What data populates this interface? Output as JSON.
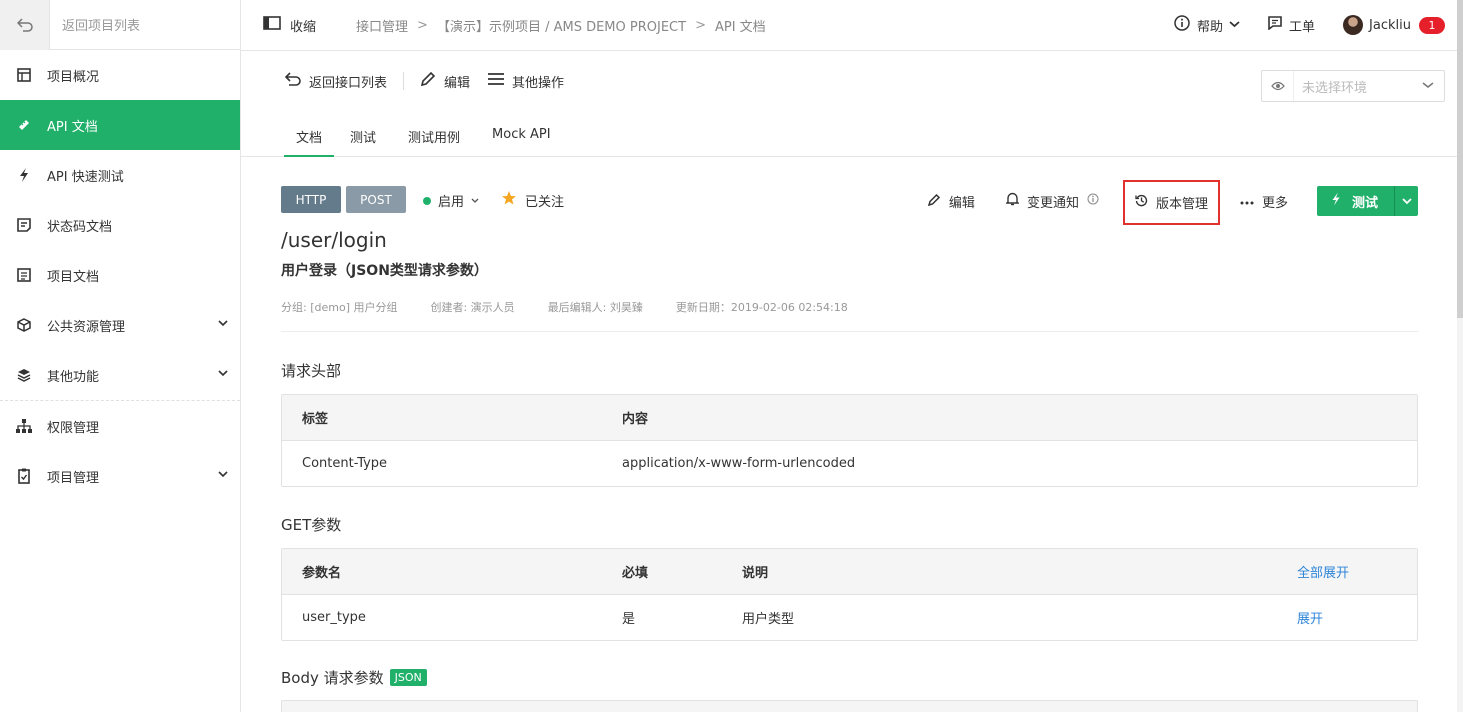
{
  "sidebar": {
    "back_label": "返回项目列表",
    "items": [
      {
        "label": "项目概况",
        "icon": "overview-icon"
      },
      {
        "label": "API 文档",
        "icon": "api-doc-icon",
        "active": true
      },
      {
        "label": "API 快速测试",
        "icon": "lightning-icon"
      },
      {
        "label": "状态码文档",
        "icon": "status-code-icon"
      },
      {
        "label": "项目文档",
        "icon": "doc-icon"
      },
      {
        "label": "公共资源管理",
        "icon": "cube-icon",
        "expandable": true
      },
      {
        "label": "其他功能",
        "icon": "layers-icon",
        "expandable": true
      },
      {
        "label": "权限管理",
        "icon": "org-chart-icon"
      },
      {
        "label": "项目管理",
        "icon": "clipboard-icon",
        "expandable": true
      }
    ]
  },
  "header": {
    "collapse_label": "收缩",
    "breadcrumbs": [
      "接口管理",
      "【演示】示例项目 / AMS DEMO PROJECT",
      "API 文档"
    ],
    "help_label": "帮助",
    "ticket_label": "工单",
    "user_name": "Jackliu",
    "notification_count": "1"
  },
  "toolbar": {
    "back_label": "返回接口列表",
    "edit_label": "编辑",
    "more_ops_label": "其他操作",
    "env_placeholder": "未选择环境",
    "tabs": [
      "文档",
      "测试",
      "测试用例",
      "Mock API"
    ]
  },
  "api": {
    "protocol": "HTTP",
    "method": "POST",
    "status": "启用",
    "follow": "已关注",
    "actions": {
      "edit": "编辑",
      "notify": "变更通知",
      "version": "版本管理",
      "more": "更多",
      "test": "测试"
    },
    "path": "/user/login",
    "name": "用户登录（JSON类型请求参数）",
    "meta": {
      "group": "分组: [demo] 用户分组",
      "creator": "创建者: 演示人员",
      "last_editor": "最后编辑人: 刘昊臻",
      "updated": "更新日期：2019-02-06 02:54:18"
    }
  },
  "request_headers": {
    "title": "请求头部",
    "columns": [
      "标签",
      "内容"
    ],
    "rows": [
      [
        "Content-Type",
        "application/x-www-form-urlencoded"
      ]
    ]
  },
  "get_params": {
    "title": "GET参数",
    "columns": [
      "参数名",
      "必填",
      "说明"
    ],
    "expand_all": "全部展开",
    "rows": [
      {
        "name": "user_type",
        "required": "是",
        "desc": "用户类型",
        "action": "展开"
      }
    ]
  },
  "body_params": {
    "title": "Body 请求参数",
    "tag": "JSON"
  },
  "colors": {
    "accent": "#20b06a",
    "link": "#2e85d9",
    "highlight_border": "#e0312c",
    "badge": "#e5202a"
  }
}
